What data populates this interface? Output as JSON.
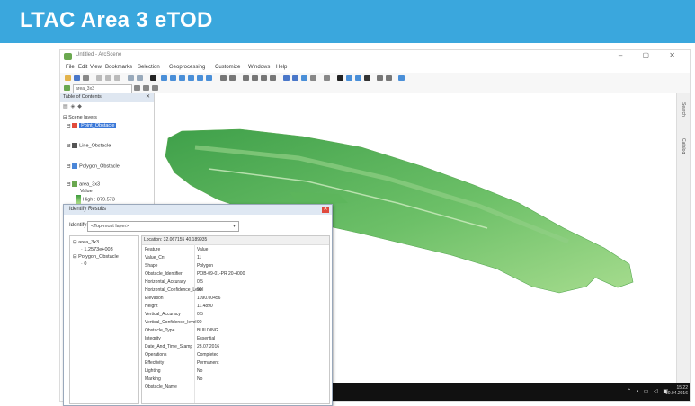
{
  "banner": {
    "title": "LTAC Area 3 eTOD",
    "color": "#3aa7dd"
  },
  "app": {
    "title": "Untitled - ArcScene",
    "menu": [
      "File",
      "Edit",
      "View",
      "Bookmarks",
      "Selection",
      "Geoprocessing",
      "Customize",
      "Windows",
      "Help"
    ],
    "layer_combo": "area_3x3"
  },
  "toc": {
    "header": "Table of Contents",
    "layers_group": "Scene layers",
    "items": [
      {
        "label": "Point_Obstacle",
        "selected": true
      },
      {
        "label": "Line_Obstacle",
        "selected": false
      },
      {
        "label": "Polygon_Obstacle",
        "selected": false
      },
      {
        "label": "area_3x3",
        "selected": false
      }
    ],
    "legend_value_label": "Value",
    "legend_high": "High : 879.573"
  },
  "right_panel": {
    "label1": "Search",
    "label2": "Catalog"
  },
  "identify": {
    "title": "Identify Results",
    "identify_label": "Identify:",
    "from_value": "<Top-most layer>",
    "tree": [
      "area_3x3",
      "1.2573e+003",
      "Polygon_Obstacle",
      "0"
    ],
    "location": "Location: 32.067155 40.189935",
    "rows": [
      {
        "field": "Feature",
        "value": "Value"
      },
      {
        "field": "Value_Cnt",
        "value": "11"
      },
      {
        "field": "Shape",
        "value": "Polygon"
      },
      {
        "field": "Obstacle_Identifier",
        "value": "POB-09-01-PR 20-4000"
      },
      {
        "field": "Horizontal_Accuracy",
        "value": "0.5"
      },
      {
        "field": "Horizontal_Confidence_Level",
        "value": "90"
      },
      {
        "field": "Elevation",
        "value": "1090.00456"
      },
      {
        "field": "Height",
        "value": "11.4890"
      },
      {
        "field": "Vertical_Accuracy",
        "value": "0.5"
      },
      {
        "field": "Vertical_Confidence_level",
        "value": "90"
      },
      {
        "field": "Obstacle_Type",
        "value": "BUILDING"
      },
      {
        "field": "Integrity",
        "value": "Essential"
      },
      {
        "field": "Date_And_Time_Stamp",
        "value": "23.07.2016"
      },
      {
        "field": "Operations",
        "value": "Completed"
      },
      {
        "field": "Effectivity",
        "value": "Permanent"
      },
      {
        "field": "Lighting",
        "value": "No"
      },
      {
        "field": "Marking",
        "value": "No"
      },
      {
        "field": "Obstacle_Name",
        "value": ""
      }
    ]
  },
  "taskbar": {
    "time": "15:22",
    "date": "10.04.2016"
  }
}
